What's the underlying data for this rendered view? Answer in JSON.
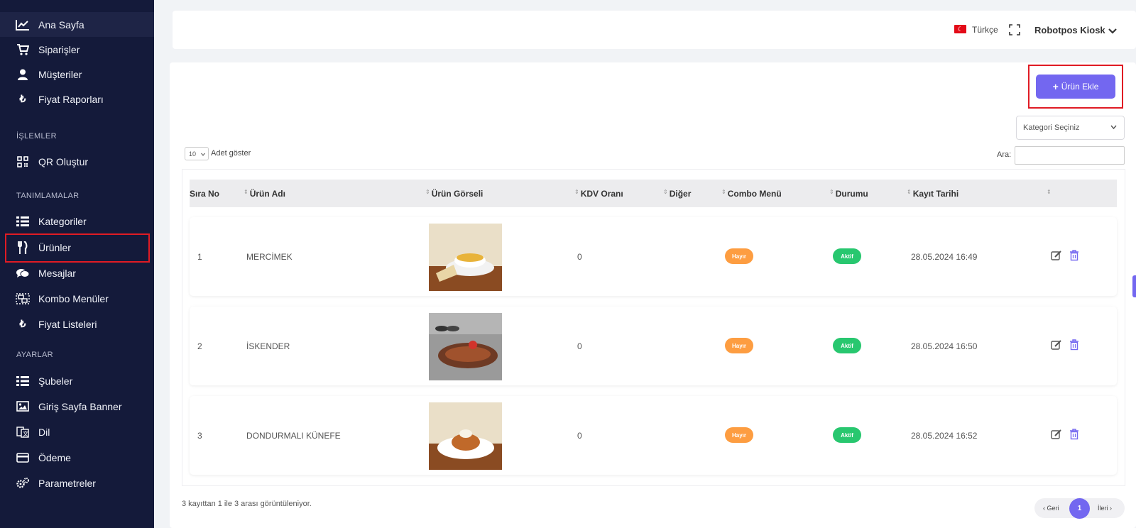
{
  "sidebar": {
    "items": [
      {
        "label": "Ana Sayfa",
        "icon": "chart-line-icon"
      },
      {
        "label": "Siparişler",
        "icon": "cart-icon"
      },
      {
        "label": "Müşteriler",
        "icon": "user-icon"
      },
      {
        "label": "Fiyat Raporları",
        "icon": "lira-icon"
      },
      {
        "label": "QR Oluştur",
        "icon": "qrcode-icon"
      },
      {
        "label": "Kategoriler",
        "icon": "list-icon"
      },
      {
        "label": "Ürünler",
        "icon": "utensils-icon"
      },
      {
        "label": "Mesajlar",
        "icon": "comments-icon"
      },
      {
        "label": "Kombo Menüler",
        "icon": "object-group-icon"
      },
      {
        "label": "Fiyat Listeleri",
        "icon": "lira-icon"
      },
      {
        "label": "Şubeler",
        "icon": "list-icon"
      },
      {
        "label": "Giriş Sayfa Banner",
        "icon": "image-icon"
      },
      {
        "label": "Dil",
        "icon": "language-icon"
      },
      {
        "label": "Ödeme",
        "icon": "credit-card-icon"
      },
      {
        "label": "Parametreler",
        "icon": "cogs-icon"
      }
    ],
    "sections": [
      "İŞLEMLER",
      "TANIMLAMALAR",
      "AYARLAR"
    ]
  },
  "topbar": {
    "language": "Türkçe",
    "user_name": "Robotpos Kiosk"
  },
  "toolbar": {
    "add_label": "Ürün Ekle",
    "category_placeholder": "Kategori Seçiniz",
    "page_length": "10",
    "page_length_label": "Adet göster",
    "search_label": "Ara:"
  },
  "table": {
    "headers": [
      "Sıra No",
      "Ürün Adı",
      "Ürün Görseli",
      "KDV Oranı",
      "Diğer",
      "Combo Menü",
      "Durumu",
      "Kayıt Tarihi",
      ""
    ],
    "rows": [
      {
        "no": "1",
        "name": "MERCİMEK",
        "kdv": "0",
        "combo": "Hayır",
        "status": "Aktif",
        "date": "28.05.2024 16:49"
      },
      {
        "no": "2",
        "name": "İSKENDER",
        "kdv": "0",
        "combo": "Hayır",
        "status": "Aktif",
        "date": "28.05.2024 16:50"
      },
      {
        "no": "3",
        "name": "DONDURMALI KÜNEFE",
        "kdv": "0",
        "combo": "Hayır",
        "status": "Aktif",
        "date": "28.05.2024 16:52"
      }
    ]
  },
  "footer": {
    "info": "3 kayıttan 1 ile 3 arası görüntüleniyor.",
    "prev": "‹ Geri",
    "current_page": "1",
    "next": "İleri ›"
  },
  "colors": {
    "sidebar_bg": "#141a3a",
    "accent": "#7367f0",
    "badge_no": "#fd9d41",
    "badge_active": "#28c76f",
    "highlight": "#e01b24"
  }
}
